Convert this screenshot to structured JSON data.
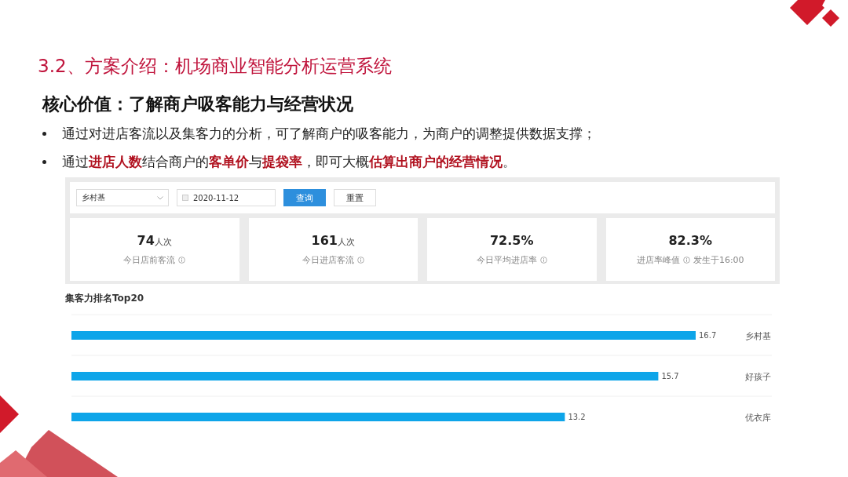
{
  "slide": {
    "title": "3.2、方案介绍：机场商业智能分析运营系统",
    "heading": "核心价值：了解商户吸客能力与经营状况",
    "bullets": [
      "通过对进店客流以及集客力的分析，可了解商户的吸客能力，为商户的调整提供数据支撑；",
      "通过**进店人数**结合商户的**客单价**与**提袋率**，即可大概**估算出商户的经营情况**。"
    ]
  },
  "dashboard": {
    "filters": {
      "store": "乡村基",
      "date": "2020-11-12",
      "query_button": "查询",
      "reset_button": "重置"
    },
    "stats": [
      {
        "value": "74",
        "unit": "人次",
        "label": "今日店前客流"
      },
      {
        "value": "161",
        "unit": "人次",
        "label": "今日进店客流"
      },
      {
        "value": "72.5%",
        "label": "今日平均进店率"
      },
      {
        "value": "82.3%",
        "label": "进店率峰值",
        "note": "发生于16:00"
      }
    ],
    "ranking": {
      "title": "集客力排名Top20",
      "chart_data": {
        "type": "bar",
        "orientation": "horizontal",
        "categories": [
          "乡村基",
          "好孩子",
          "优衣库"
        ],
        "series": [
          {
            "color": "#0ea5e9",
            "values": [
              16.7,
              15.7,
              13.2
            ]
          }
        ],
        "data_labels": true
      }
    }
  }
}
